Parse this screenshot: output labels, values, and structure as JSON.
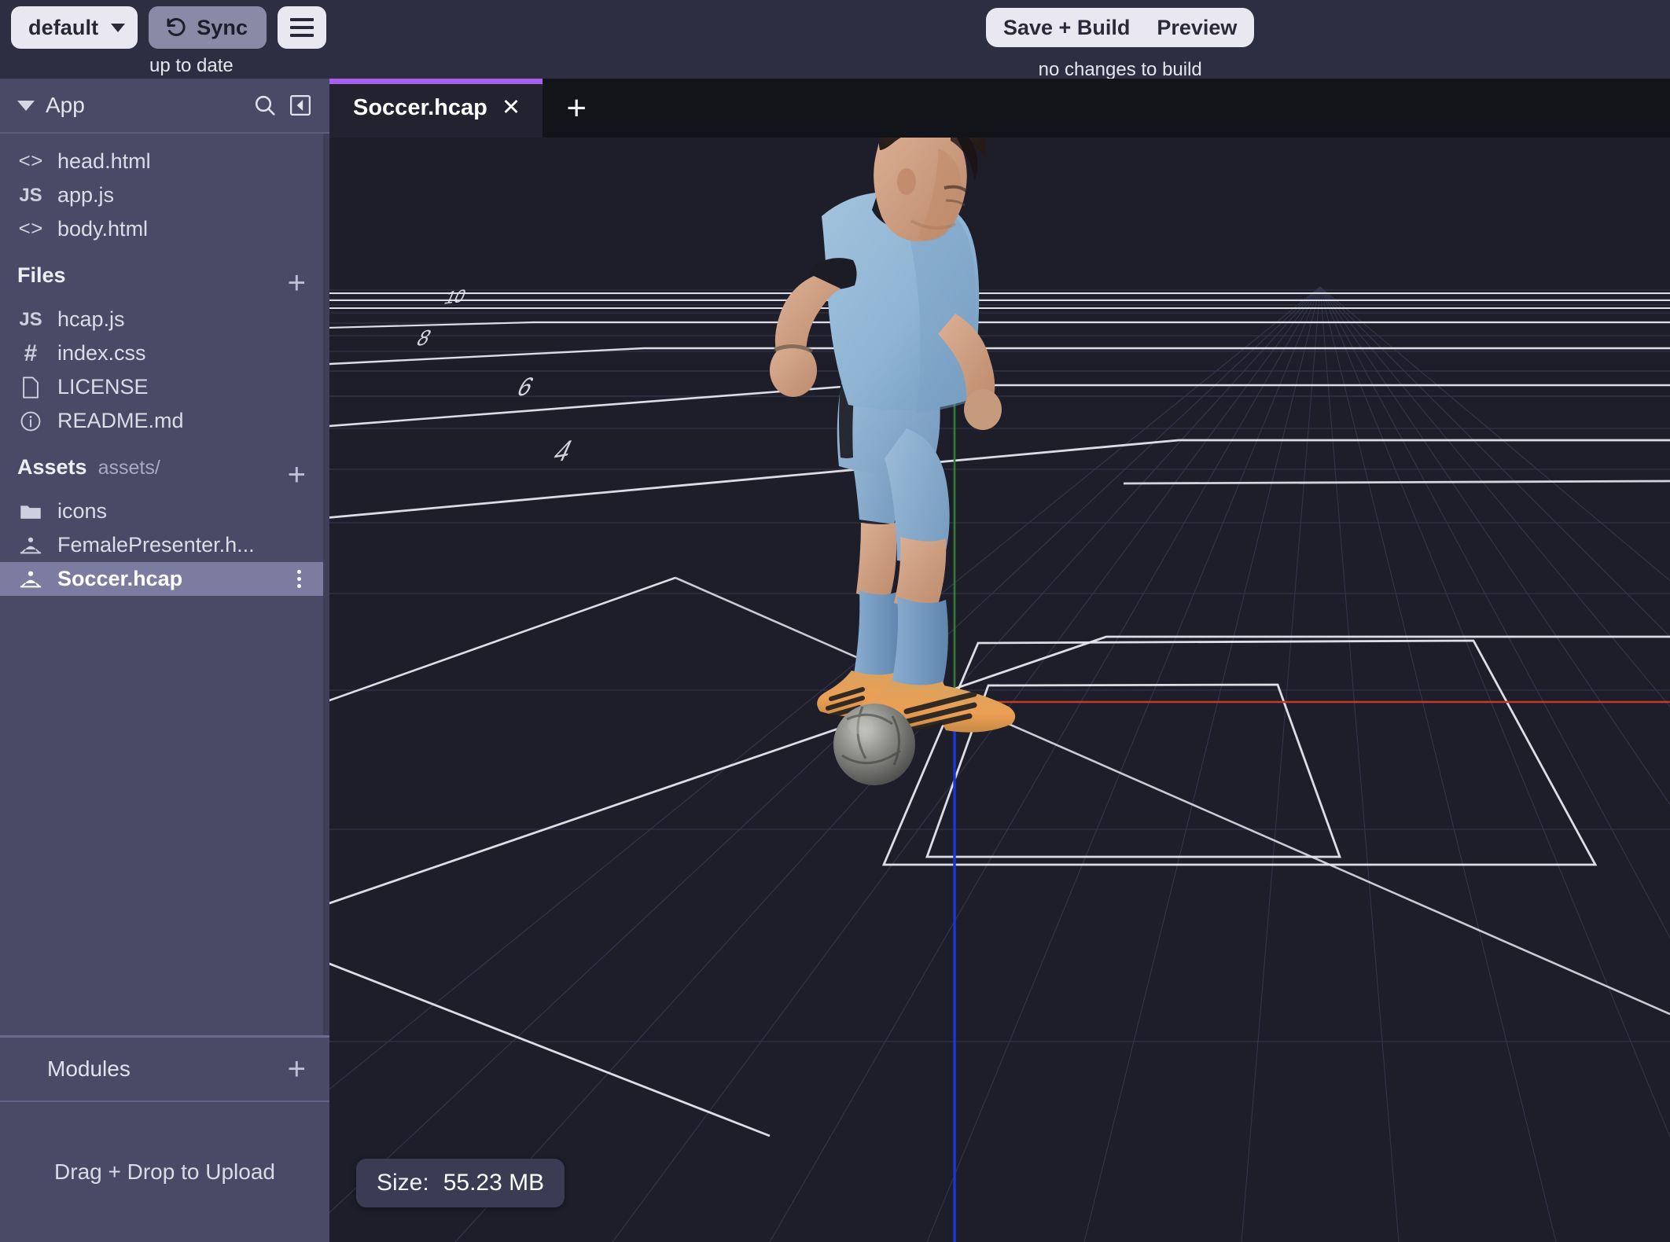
{
  "topbar": {
    "branch_label": "default",
    "branch_caret_icon": "chevron-down-icon",
    "sync_label": "Sync",
    "sync_icon": "undo-rotate-icon",
    "menu_icon": "hamburger-icon",
    "sync_status": "up to date",
    "save_build_label": "Save + Build",
    "preview_label": "Preview",
    "build_status": "no changes to build"
  },
  "sidebar": {
    "header": {
      "title": "App",
      "collapse_caret_icon": "caret-down-icon",
      "search_icon": "search-icon",
      "panel_collapse_icon": "collapse-panel-left-icon"
    },
    "app_files": [
      {
        "name": "head.html",
        "icon": "code-brackets-icon",
        "icon_text": "<>"
      },
      {
        "name": "app.js",
        "icon": "js-file-icon",
        "icon_text": "JS"
      },
      {
        "name": "body.html",
        "icon": "code-brackets-icon",
        "icon_text": "<>"
      }
    ],
    "files_section": {
      "title": "Files",
      "add_icon": "plus-icon",
      "items": [
        {
          "name": "hcap.js",
          "icon": "js-file-icon",
          "icon_text": "JS"
        },
        {
          "name": "index.css",
          "icon": "css-hash-icon",
          "icon_text": "#"
        },
        {
          "name": "LICENSE",
          "icon": "document-icon",
          "icon_text": ""
        },
        {
          "name": "README.md",
          "icon": "info-circle-icon",
          "icon_text": ""
        }
      ]
    },
    "assets_section": {
      "title": "Assets",
      "path": "assets/",
      "add_icon": "plus-icon",
      "items": [
        {
          "name": "icons",
          "icon": "folder-icon",
          "selected": false
        },
        {
          "name": "FemalePresenter.h...",
          "icon": "hologram-capture-icon",
          "selected": false
        },
        {
          "name": "Soccer.hcap",
          "icon": "hologram-capture-icon",
          "selected": true,
          "menu_icon": "kebab-menu-icon"
        }
      ]
    },
    "modules": {
      "title": "Modules",
      "add_icon": "plus-icon"
    },
    "dropzone_label": "Drag + Drop to Upload"
  },
  "tabs": {
    "items": [
      {
        "label": "Soccer.hcap",
        "active": true,
        "close_icon": "close-icon"
      }
    ],
    "new_tab_icon": "plus-icon",
    "active_accent": "#a560f0"
  },
  "viewport": {
    "size_label": "Size:",
    "size_value": "55.23 MB",
    "background": "#1e1e2b",
    "axis_colors": {
      "x": "#c0392b",
      "y": "#2f7d32",
      "z": "#1a36d8"
    },
    "grid_color": "#3a3a55",
    "field_line_color": "#e8e8f0",
    "field_numbers": [
      "10",
      "8",
      "6",
      "4"
    ],
    "subject": {
      "name": "soccer-player-capture",
      "jersey_color": "#8fb4d4",
      "collar_color": "#1c1c24",
      "shorts_color": "#8fb4d4",
      "socks_color": "#7ea2c8",
      "boot_color": "#e8a15a",
      "skin_color": "#d2a184",
      "hair_color": "#2b1f1c",
      "ball_color": "#8b8b88"
    }
  }
}
